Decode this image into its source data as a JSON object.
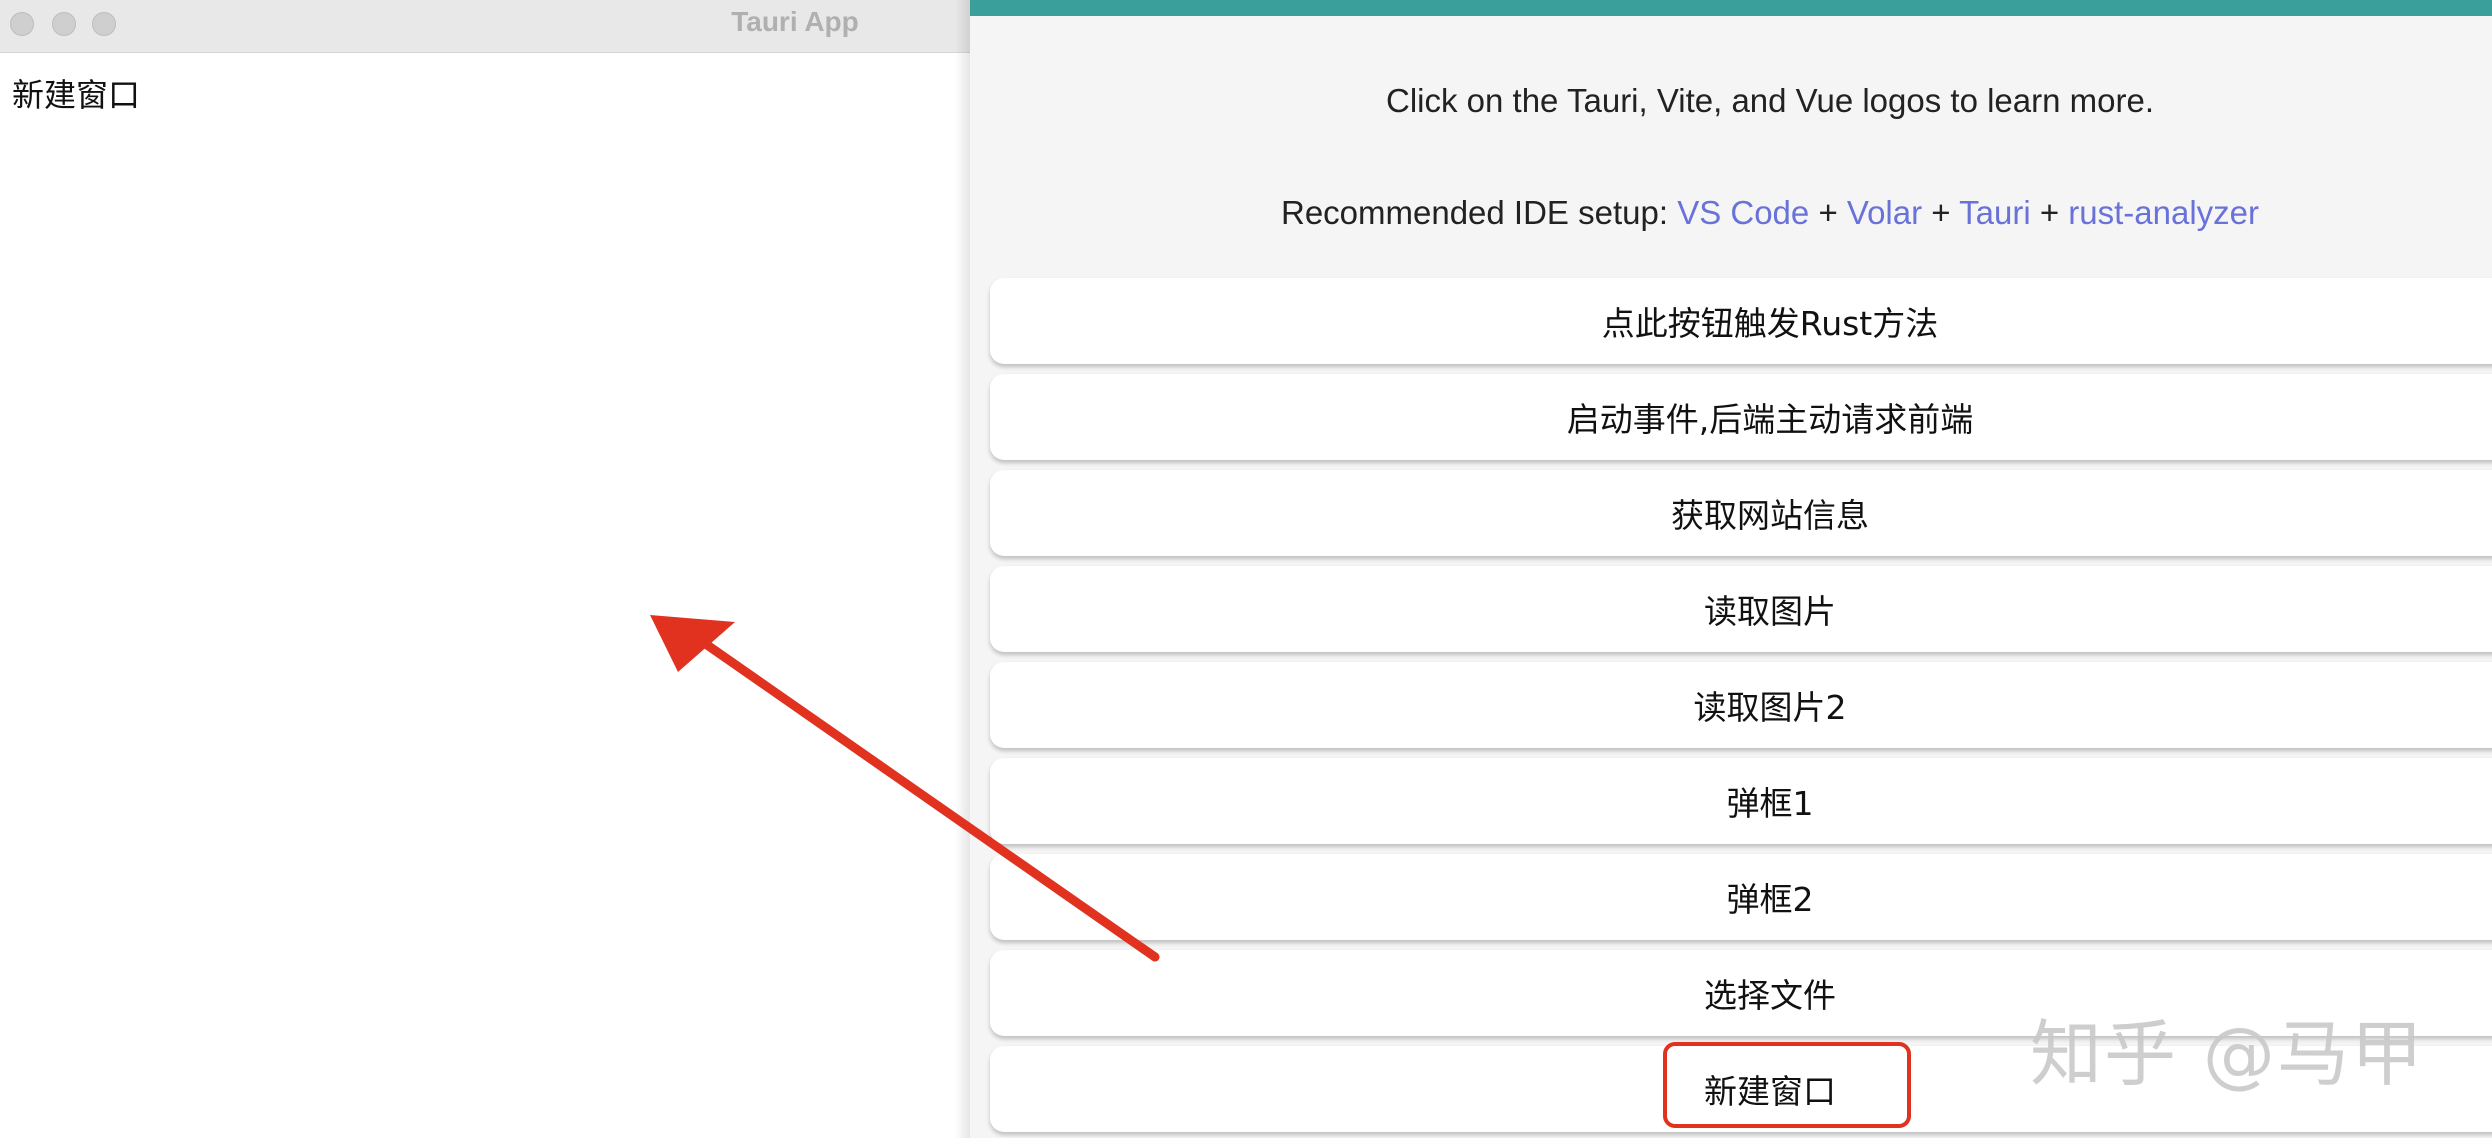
{
  "left_window": {
    "title": "Tauri App",
    "content_text": "新建窗口"
  },
  "main": {
    "intro": "Click on the Tauri, Vite, and Vue logos to learn more.",
    "ide_prefix": "Recommended IDE setup: ",
    "ide_links": [
      "VS Code",
      "Volar",
      "Tauri",
      "rust-analyzer"
    ],
    "ide_separator": " + ",
    "buttons": [
      "点此按钮触发Rust方法",
      "启动事件,后端主动请求前端",
      "获取网站信息",
      "读取图片",
      "读取图片2",
      "弹框1",
      "弹框2",
      "选择文件",
      "新建窗口"
    ]
  },
  "watermark": "知乎 @马甲",
  "colors": {
    "accent_bar": "#3a9f9b",
    "link": "#6872d9",
    "annotation_red": "#e0321f"
  },
  "icons": [
    "close-traffic-light",
    "minimize-traffic-light",
    "zoom-traffic-light",
    "annotation-arrow"
  ]
}
